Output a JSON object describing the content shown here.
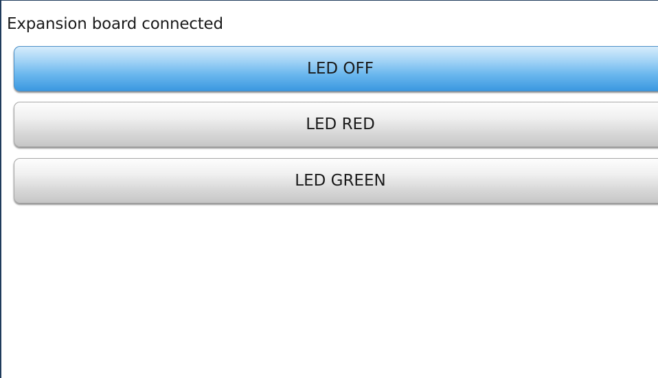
{
  "status": {
    "text": "Expansion board connected"
  },
  "buttons": {
    "led_off": "LED OFF",
    "led_red": "LED RED",
    "led_green": "LED GREEN"
  },
  "colors": {
    "active_button": "#3b98e0",
    "normal_button": "#d8d8d8"
  }
}
